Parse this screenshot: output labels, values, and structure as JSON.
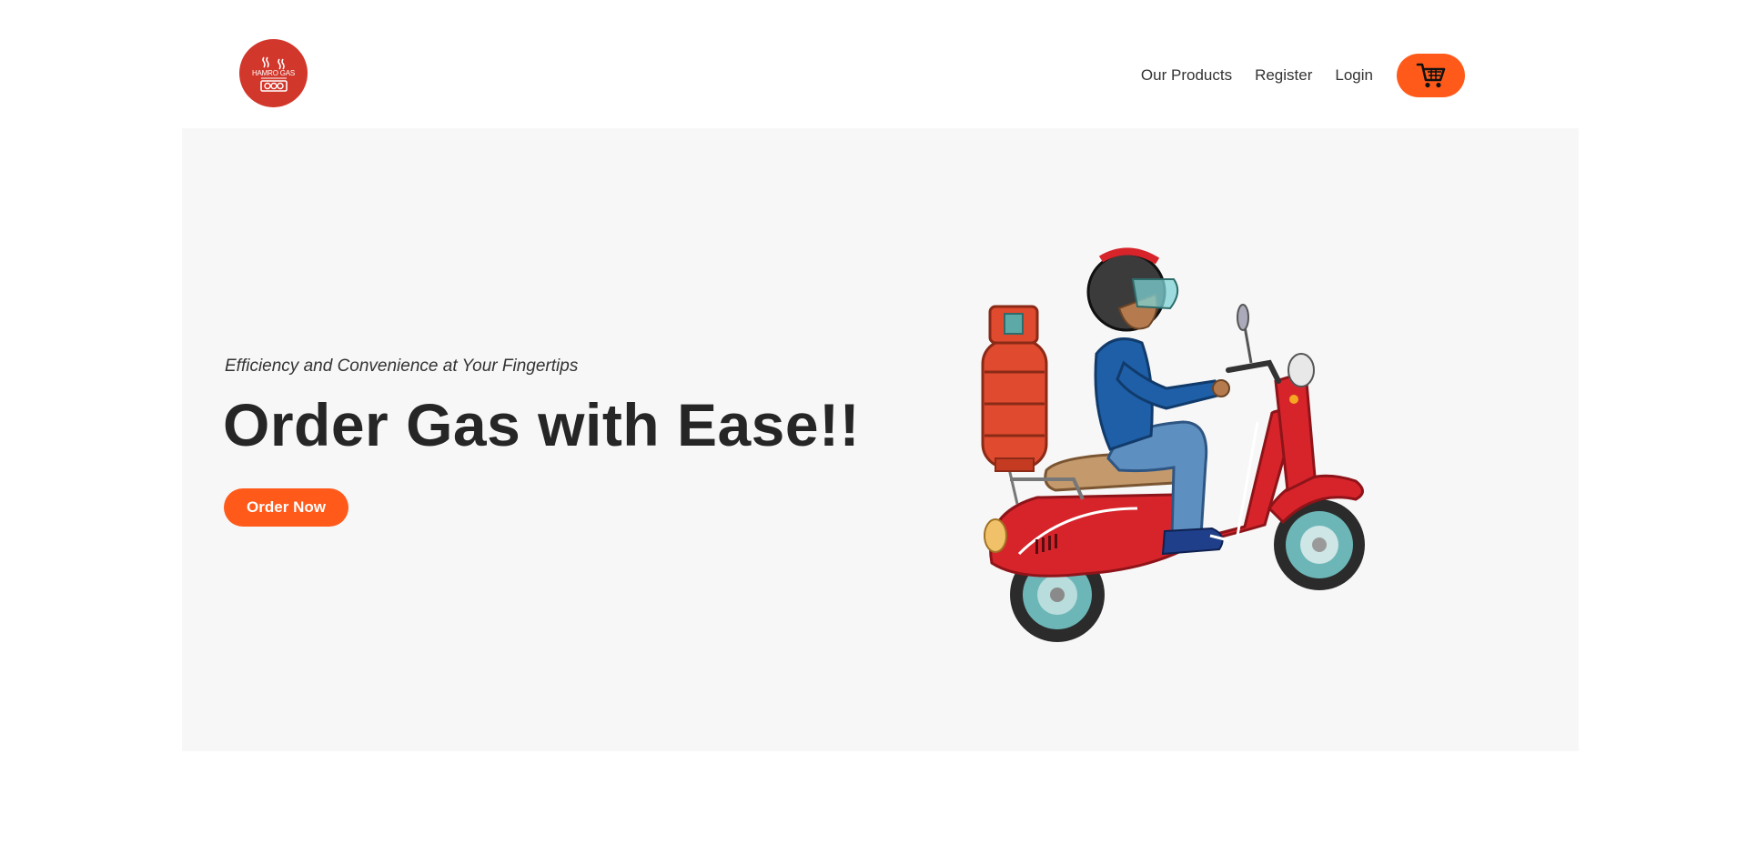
{
  "header": {
    "logo": {
      "text": "HAMRO GAS",
      "icon": "gas-stove-logo-icon",
      "color": "#d2372b"
    },
    "nav": {
      "products_label": "Our Products",
      "register_label": "Register",
      "login_label": "Login",
      "cart_icon": "shopping-cart-icon"
    }
  },
  "hero": {
    "tagline": "Efficiency and Convenience at Your Fingertips",
    "headline": "Order Gas with Ease!!",
    "cta_label": "Order Now",
    "illustration": "delivery-scooter-with-gas-cylinder"
  },
  "colors": {
    "accent": "#ff5a1a",
    "logo_red": "#d2372b",
    "hero_bg": "#f7f7f7",
    "text_dark": "#262626"
  }
}
